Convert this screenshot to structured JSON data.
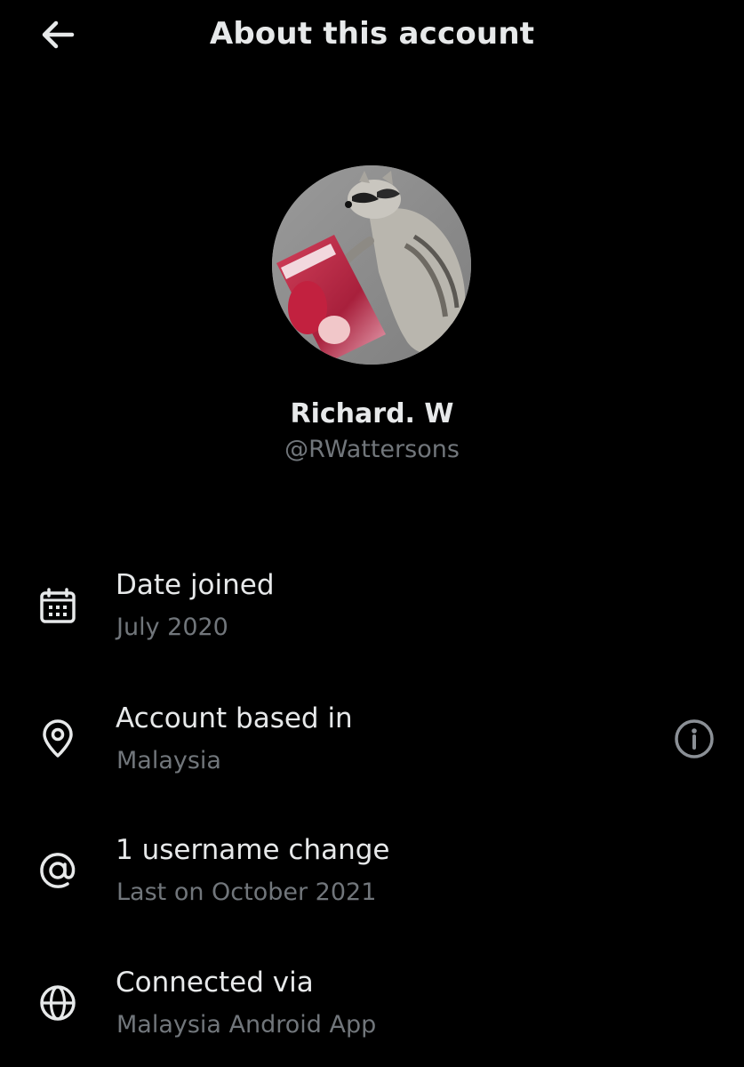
{
  "header": {
    "title": "About this account",
    "back_icon": "arrow-left-icon"
  },
  "profile": {
    "display_name": "Richard. W",
    "handle": "@RWattersons",
    "avatar_description_icon": "avatar-image"
  },
  "rows": [
    {
      "icon": "calendar-icon",
      "label": "Date joined",
      "value": "July 2020"
    },
    {
      "icon": "location-pin-icon",
      "label": "Account based in",
      "value": "Malaysia",
      "action_icon": "info-icon"
    },
    {
      "icon": "at-sign-icon",
      "label": "1 username change",
      "value": "Last on October 2021"
    },
    {
      "icon": "globe-icon",
      "label": "Connected via",
      "value": "Malaysia Android App"
    }
  ],
  "colors": {
    "background": "#000000",
    "primary_text": "#e7e9ea",
    "secondary_text": "#71767b"
  }
}
